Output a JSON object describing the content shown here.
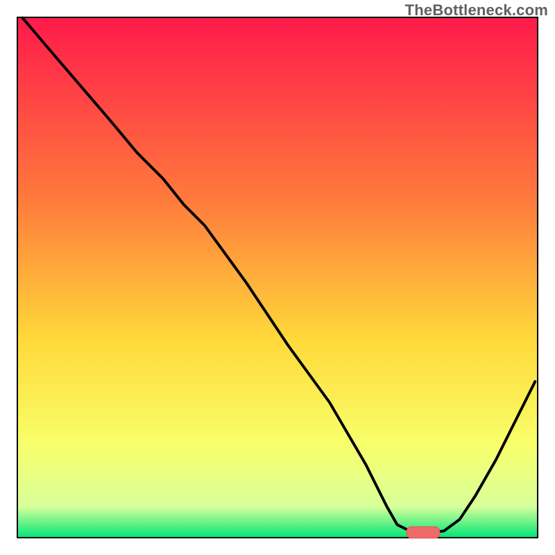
{
  "watermark": "TheBottleneck.com",
  "colors": {
    "curve": "#000000",
    "marker_fill": "#f06a6a",
    "marker_stroke": "#e25555",
    "axis": "#000000",
    "grad_top": "#ff1a4b",
    "grad_mid1": "#ff7a3c",
    "grad_mid2": "#ffd93a",
    "grad_low1": "#f8ff6a",
    "grad_low2": "#d8ff9a",
    "grad_bottom": "#00e676"
  },
  "chart_data": {
    "type": "line",
    "title": "",
    "xlabel": "",
    "ylabel": "",
    "xlim": [
      0,
      100
    ],
    "ylim": [
      0,
      100
    ],
    "notes": "V-shaped curve on vertical rainbow gradient; values estimated from pixel positions (no axis ticks present). Small rounded marker sits at the trough.",
    "series": [
      {
        "name": "curve",
        "x": [
          1,
          6,
          12,
          18,
          23,
          28,
          32,
          36,
          44,
          52,
          60,
          67,
          71,
          73,
          76,
          80,
          82,
          85,
          88,
          92,
          96,
          99.5
        ],
        "y": [
          99.9,
          94,
          87,
          80,
          74,
          69,
          64,
          60,
          49,
          37,
          26,
          14,
          6,
          2.5,
          1.0,
          1.0,
          1.3,
          3.5,
          8,
          15,
          23,
          30
        ]
      }
    ],
    "marker": {
      "x": 78,
      "y": 1.0,
      "rx": 3.2,
      "ry": 1.1
    }
  }
}
